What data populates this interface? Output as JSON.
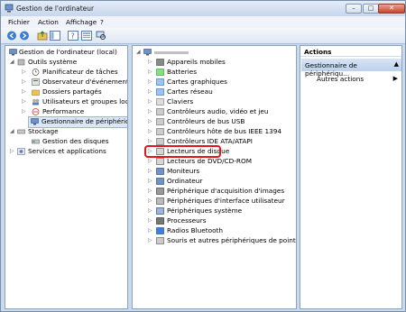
{
  "window": {
    "title": "Gestion de l'ordinateur",
    "minimize": "–",
    "maximize": "□",
    "close": "✕"
  },
  "menu": [
    "Fichier",
    "Action",
    "Affichage",
    "?"
  ],
  "left_tree": [
    {
      "label": "Gestion de l'ordinateur (local)",
      "arrow": ""
    },
    {
      "label": "Outils système",
      "arrow": "◢"
    },
    {
      "label": "Planificateur de tâches",
      "arrow": "▷"
    },
    {
      "label": "Observateur d'événements",
      "arrow": "▷"
    },
    {
      "label": "Dossiers partagés",
      "arrow": "▷"
    },
    {
      "label": "Utilisateurs et groupes locaux",
      "arrow": "▷"
    },
    {
      "label": "Performance",
      "arrow": "▷"
    },
    {
      "label": "Gestionnaire de périphériques",
      "arrow": ""
    },
    {
      "label": "Stockage",
      "arrow": "◢"
    },
    {
      "label": "Gestion des disques",
      "arrow": ""
    },
    {
      "label": "Services et applications",
      "arrow": "▷"
    }
  ],
  "devices": [
    "Appareils mobiles",
    "Batteries",
    "Cartes graphiques",
    "Cartes réseau",
    "Claviers",
    "Contrôleurs audio, vidéo et jeu",
    "Contrôleurs de bus USB",
    "Contrôleurs hôte de bus IEEE 1394",
    "Contrôleurs IDE ATA/ATAPI",
    "Lecteurs de disque",
    "Lecteurs de DVD/CD-ROM",
    "Moniteurs",
    "Ordinateur",
    "Périphérique d'acquisition d'images",
    "Périphériques d'interface utilisateur",
    "Périphériques système",
    "Processeurs",
    "Radios Bluetooth",
    "Souris et autres périphériques de pointage"
  ],
  "actions": {
    "header": "Actions",
    "selected": "Gestionnaire de périphériqu...",
    "more": "Autres actions"
  }
}
